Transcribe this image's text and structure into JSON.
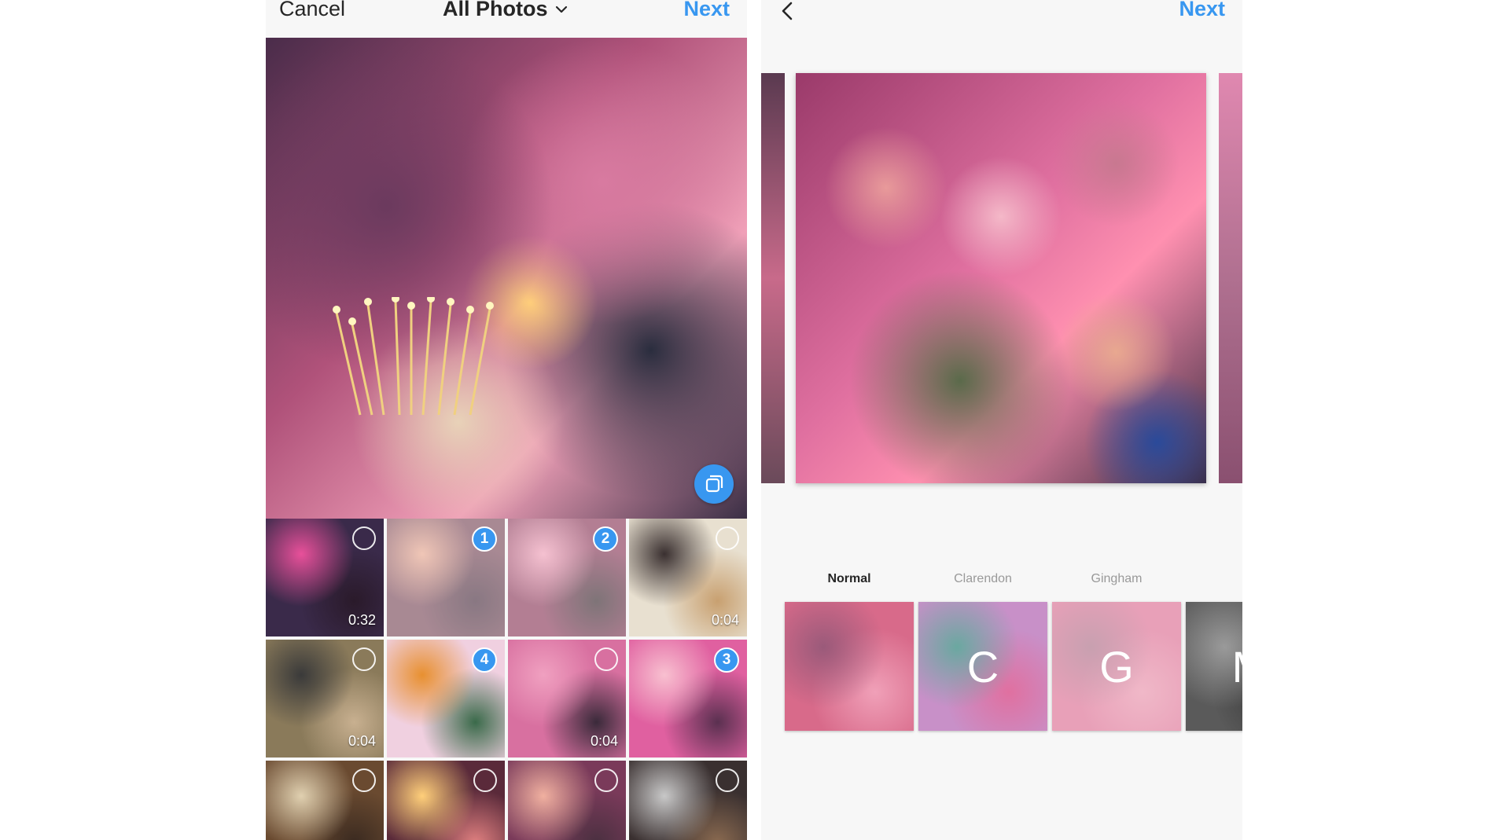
{
  "left_screen": {
    "cancel_label": "Cancel",
    "album_label": "All Photos",
    "next_label": "Next",
    "grid": [
      {
        "selected_index": "",
        "duration": "0:32",
        "selected": false,
        "bg": [
          "#3a2a4a",
          "#e8509a",
          "#2a1a2a"
        ]
      },
      {
        "selected_index": "1",
        "duration": "",
        "selected": true,
        "bg": [
          "#7a4a5a",
          "#e8a890",
          "#4a3040"
        ]
      },
      {
        "selected_index": "2",
        "duration": "",
        "selected": true,
        "bg": [
          "#8a3a5a",
          "#f0a0b8",
          "#3a2a30"
        ]
      },
      {
        "selected_index": "",
        "duration": "0:04",
        "selected": false,
        "bg": [
          "#e8e0d0",
          "#3a3030",
          "#c8a070"
        ]
      },
      {
        "selected_index": "",
        "duration": "0:04",
        "selected": false,
        "bg": [
          "#8a7a5a",
          "#3a3a3a",
          "#c8b090"
        ]
      },
      {
        "selected_index": "4",
        "duration": "",
        "selected": false,
        "bg": [
          "#f0d0e0",
          "#e89030",
          "#3a6a4a"
        ]
      },
      {
        "selected_index": "",
        "duration": "0:04",
        "selected": false,
        "bg": [
          "#d870a0",
          "#f0a0c0",
          "#3a2a3a"
        ]
      },
      {
        "selected_index": "3",
        "duration": "",
        "selected": false,
        "bg": [
          "#e060a0",
          "#f8c0d0",
          "#5a3050"
        ]
      },
      {
        "selected_index": "",
        "duration": "",
        "selected": false,
        "bg": [
          "#6a4a30",
          "#e0d0b0",
          "#3a2a20"
        ]
      },
      {
        "selected_index": "",
        "duration": "",
        "selected": false,
        "bg": [
          "#5a2a3a",
          "#ffcf7a",
          "#e08080"
        ]
      },
      {
        "selected_index": "",
        "duration": "",
        "selected": false,
        "bg": [
          "#7a3a5a",
          "#f0b0a0",
          "#4a3040"
        ]
      },
      {
        "selected_index": "",
        "duration": "",
        "selected": false,
        "bg": [
          "#3a3030",
          "#c8c8c8",
          "#8a6a50"
        ]
      }
    ]
  },
  "right_screen": {
    "next_label": "Next",
    "filters": [
      {
        "name": "Normal",
        "letter": "",
        "active": true,
        "bg": [
          "#d86a8a",
          "#9a5a7a",
          "#f0a0b8"
        ]
      },
      {
        "name": "Clarendon",
        "letter": "C",
        "active": false,
        "bg": [
          "#c890c8",
          "#6aa8a0",
          "#e070a0"
        ]
      },
      {
        "name": "Gingham",
        "letter": "G",
        "active": false,
        "bg": [
          "#e8a0b8",
          "#c8a0b0",
          "#f0b8c8"
        ]
      },
      {
        "name": "M",
        "letter": "M",
        "active": false,
        "bg": [
          "#5a5a5a",
          "#9a9a9a",
          "#3a3a3a"
        ]
      }
    ]
  },
  "colors": {
    "accent": "#3897f0",
    "text": "#262626",
    "muted": "#999999",
    "background": "#f7f7f7"
  },
  "icons": {
    "album_dropdown": "chevron-down-icon",
    "multi_select": "multi-select-icon",
    "back": "chevron-left-icon"
  }
}
